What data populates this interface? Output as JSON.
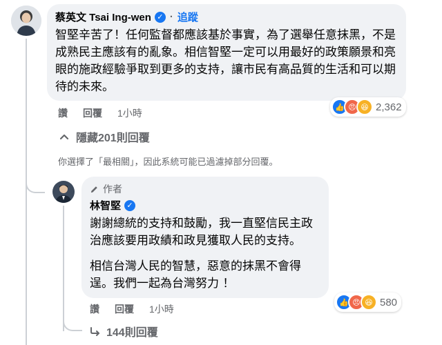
{
  "comment": {
    "author": "蔡英文 Tsai Ing-wen",
    "follow_label": "追蹤",
    "text": "智堅辛苦了！任何監督都應該基於事實，為了選舉任意抹黑，不是成熟民主應該有的亂象。相信智堅一定可以用最好的政策願景和亮眼的施政經驗爭取到更多的支持，讓市民有高品質的生活和可以期待的未來。",
    "actions": {
      "read": "讚",
      "reply": "回覆",
      "time": "1小時"
    },
    "reactions_count": "2,362"
  },
  "hide_replies_label": "隱藏201則回覆",
  "filter_notice": "你選擇了「最相關」，因此系統可能已過濾掉部分回覆。",
  "reply": {
    "badge": "作者",
    "author": "林智堅",
    "text1": "謝謝總統的支持和鼓勵，我一直堅信民主政治應該要用政績和政見獲取人民的支持。",
    "text2": "相信台灣人民的智慧，惡意的抹黑不會得逞。我們一起為台灣努力 ！",
    "actions": {
      "read": "讚",
      "reply": "回覆",
      "time": "1小時"
    },
    "reactions_count": "580"
  },
  "more_replies_label": "144則回覆",
  "colors": {
    "accent": "#1877f2",
    "bubble": "#f0f2f5",
    "muted": "#65676b"
  }
}
